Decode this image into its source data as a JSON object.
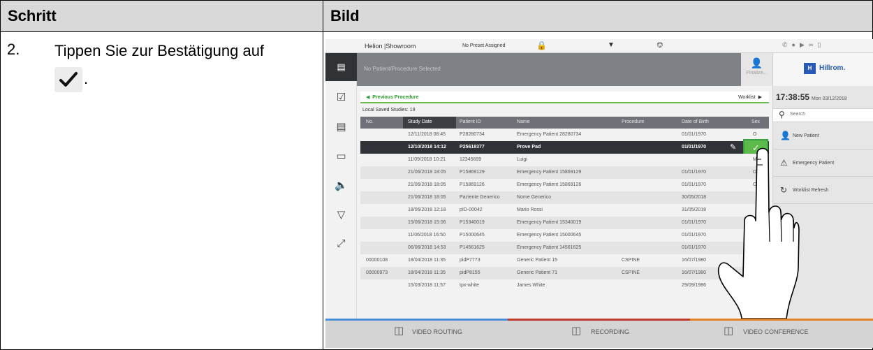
{
  "doc": {
    "header_step": "Schritt",
    "header_image": "Bild",
    "step_number": "2.",
    "step_text": "Tippen Sie zur Bestätigung auf",
    "step_text_end": ".",
    "step_icon": "checkmark-icon"
  },
  "app": {
    "title": "Helion |Showroom",
    "preset": "No Preset Assigned",
    "patient_placeholder": "No Patient/Procedure Selected",
    "finalize_label": "Finalize...",
    "brand": "Hillrom.",
    "brand_mark": "H",
    "clock_time": "17:38:55",
    "clock_date": "Mon 03/12/2018",
    "search_placeholder": "Search",
    "right_buttons": [
      {
        "label": "New Patient",
        "icon": "add-user-icon"
      },
      {
        "label": "Emergency Patient",
        "icon": "emergency-icon"
      },
      {
        "label": "Worklist Refresh",
        "icon": "refresh-icon"
      }
    ],
    "previous_procedure": "Previous Procedure",
    "worklist": "Worklist",
    "local_saved": "Local Saved Studies: 19",
    "columns": [
      "No.",
      "Study Date",
      "Patient ID",
      "Name",
      "Procedure",
      "Date of Birth",
      "Sex"
    ],
    "rows": [
      [
        "",
        "12/11/2018 08:45",
        "P28280734",
        "Emergency Patient 28280734",
        "",
        "01/01/1970",
        "O"
      ],
      [
        "",
        "12/10/2018 14:12",
        "P25618377",
        "Prove Pad",
        "",
        "01/01/1970",
        ""
      ],
      [
        "",
        "11/09/2018 10:21",
        "12345699",
        "Luigi",
        "",
        "",
        "M"
      ],
      [
        "",
        "21/06/2018 18:05",
        "P15869129",
        "Emergency Patient 15869129",
        "",
        "01/01/1970",
        "O"
      ],
      [
        "",
        "21/06/2018 18:05",
        "P15869126",
        "Emergency Patient 15869126",
        "",
        "01/01/1970",
        "O"
      ],
      [
        "",
        "21/06/2018 18:05",
        "Paziente Generico",
        "Nome Generico",
        "",
        "30/05/2018",
        ""
      ],
      [
        "",
        "18/06/2018 12:18",
        "pID-00042",
        "Mario Rossi",
        "",
        "31/05/2018",
        ""
      ],
      [
        "",
        "15/06/2018 15:06",
        "P15340019",
        "Emergency Patient 15340019",
        "",
        "01/01/1970",
        ""
      ],
      [
        "",
        "11/06/2018 16:50",
        "P15000645",
        "Emergency Patient 15000645",
        "",
        "01/01/1970",
        ""
      ],
      [
        "",
        "06/06/2018 14:53",
        "P14561625",
        "Emergency Patient 14561625",
        "",
        "01/01/1970",
        ""
      ],
      [
        "00000108",
        "18/04/2018 11:35",
        "pidP7773",
        "Generic Patient 15",
        "CSPINE",
        "16/07/1980",
        ""
      ],
      [
        "00000973",
        "18/04/2018 11:35",
        "pidP8155",
        "Generic Patient 71",
        "CSPINE",
        "16/07/1980",
        ""
      ],
      [
        "",
        "15/03/2018 11:57",
        "tpx-white",
        "James White",
        "",
        "29/09/1986",
        ""
      ]
    ],
    "selected_row": 1,
    "bottom": [
      "VIDEO ROUTING",
      "RECORDING",
      "VIDEO CONFERENCE"
    ],
    "colors": {
      "accent_green": "#5bba4a",
      "brand_blue": "#2859b5",
      "strip_blue": "#4a90d9",
      "strip_red": "#c0392b",
      "strip_orange": "#e67e22"
    }
  }
}
